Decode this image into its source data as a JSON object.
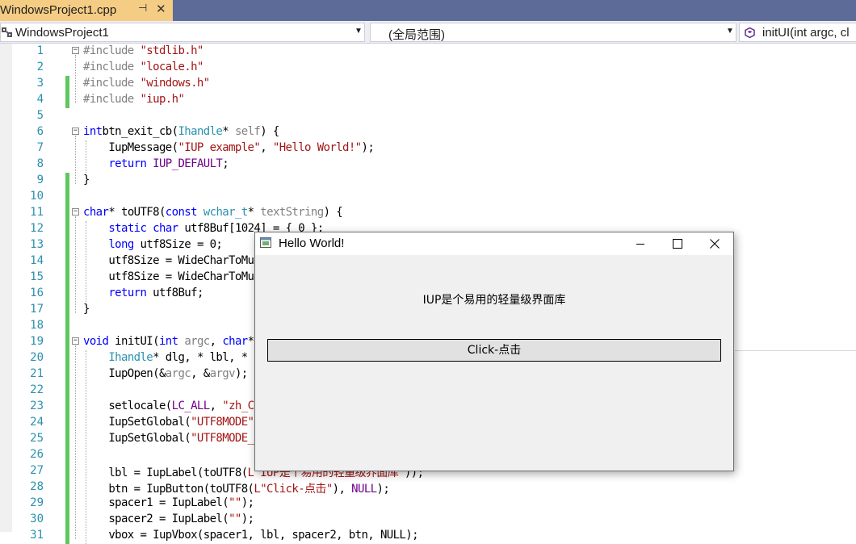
{
  "tab": {
    "title": "WindowsProject1.cpp",
    "pin_icon": "pin-icon",
    "close_icon": "close-icon"
  },
  "nav": {
    "project": "WindowsProject1",
    "scope": "(全局范围)",
    "member": "initUI(int argc, cl"
  },
  "code_lines": [
    {
      "n": "1",
      "chg": false,
      "fold": true,
      "parts": [
        [
          "pp",
          "#include "
        ],
        [
          "str",
          "\"stdlib.h\""
        ]
      ]
    },
    {
      "n": "2",
      "chg": false,
      "fold": false,
      "parts": [
        [
          "pp",
          "#include "
        ],
        [
          "str",
          "\"locale.h\""
        ]
      ]
    },
    {
      "n": "3",
      "chg": true,
      "fold": false,
      "parts": [
        [
          "pp",
          "#include "
        ],
        [
          "str",
          "\"windows.h\""
        ]
      ]
    },
    {
      "n": "4",
      "chg": true,
      "fold": false,
      "parts": [
        [
          "pp",
          "#include "
        ],
        [
          "str",
          "\"iup.h\""
        ]
      ]
    },
    {
      "n": "5",
      "chg": false,
      "fold": false,
      "parts": []
    },
    {
      "n": "6",
      "chg": false,
      "fold": true,
      "parts": [
        [
          "kw",
          "int"
        ],
        [
          "",
          "btn_exit_cb("
        ],
        [
          "ty",
          "Ihandle"
        ],
        [
          "",
          "* "
        ],
        [
          "prm",
          "self"
        ],
        [
          "",
          ") {"
        ]
      ]
    },
    {
      "n": "7",
      "chg": false,
      "fold": false,
      "parts": [
        [
          "",
          "    IupMessage("
        ],
        [
          "str",
          "\"IUP example\""
        ],
        [
          "",
          ", "
        ],
        [
          "str",
          "\"Hello World!\""
        ],
        [
          "",
          ");"
        ]
      ]
    },
    {
      "n": "8",
      "chg": false,
      "fold": false,
      "parts": [
        [
          "",
          "    "
        ],
        [
          "kw",
          "return"
        ],
        [
          "mac",
          " IUP_DEFAULT"
        ],
        [
          "",
          ";"
        ]
      ]
    },
    {
      "n": "9",
      "chg": true,
      "fold": false,
      "parts": [
        [
          "",
          "}"
        ]
      ]
    },
    {
      "n": "10",
      "chg": true,
      "fold": false,
      "parts": []
    },
    {
      "n": "11",
      "chg": true,
      "fold": true,
      "parts": [
        [
          "kw",
          "char"
        ],
        [
          "",
          "* toUTF8("
        ],
        [
          "kw",
          "const"
        ],
        [
          "",
          " "
        ],
        [
          "ty",
          "wchar_t"
        ],
        [
          "",
          "* "
        ],
        [
          "prm",
          "textString"
        ],
        [
          "",
          ") {"
        ]
      ]
    },
    {
      "n": "12",
      "chg": true,
      "fold": false,
      "parts": [
        [
          "",
          "    "
        ],
        [
          "kw",
          "static"
        ],
        [
          "",
          " "
        ],
        [
          "kw",
          "char"
        ],
        [
          "",
          " utf8Buf[1024] = { 0 };"
        ]
      ]
    },
    {
      "n": "13",
      "chg": true,
      "fold": false,
      "parts": [
        [
          "",
          "    "
        ],
        [
          "kw",
          "long"
        ],
        [
          "",
          " utf8Size = 0;"
        ]
      ]
    },
    {
      "n": "14",
      "chg": true,
      "fold": false,
      "parts": [
        [
          "",
          "    utf8Size = WideCharToMu"
        ]
      ]
    },
    {
      "n": "15",
      "chg": true,
      "fold": false,
      "parts": [
        [
          "",
          "    utf8Size = WideCharToMu"
        ]
      ]
    },
    {
      "n": "16",
      "chg": true,
      "fold": false,
      "parts": [
        [
          "",
          "    "
        ],
        [
          "kw",
          "return"
        ],
        [
          "",
          " utf8Buf;"
        ]
      ]
    },
    {
      "n": "17",
      "chg": true,
      "fold": false,
      "parts": [
        [
          "",
          "}"
        ]
      ]
    },
    {
      "n": "18",
      "chg": true,
      "fold": false,
      "parts": []
    },
    {
      "n": "19",
      "chg": true,
      "fold": true,
      "parts": [
        [
          "kw",
          "void"
        ],
        [
          "",
          " initUI("
        ],
        [
          "kw",
          "int"
        ],
        [
          "",
          " "
        ],
        [
          "prm",
          "argc"
        ],
        [
          "",
          ", "
        ],
        [
          "kw",
          "char"
        ],
        [
          "",
          "*"
        ]
      ]
    },
    {
      "n": "20",
      "chg": true,
      "fold": false,
      "parts": [
        [
          "",
          "    "
        ],
        [
          "ty",
          "Ihandle"
        ],
        [
          "",
          "* dlg, * lbl, *"
        ]
      ]
    },
    {
      "n": "21",
      "chg": true,
      "fold": false,
      "parts": [
        [
          "",
          "    IupOpen(&"
        ],
        [
          "prm",
          "argc"
        ],
        [
          "",
          ", &"
        ],
        [
          "prm",
          "argv"
        ],
        [
          "",
          ");"
        ]
      ]
    },
    {
      "n": "22",
      "chg": true,
      "fold": false,
      "parts": []
    },
    {
      "n": "23",
      "chg": true,
      "fold": false,
      "parts": [
        [
          "",
          "    setlocale("
        ],
        [
          "mac",
          "LC_ALL"
        ],
        [
          "",
          ", "
        ],
        [
          "str",
          "\"zh_C"
        ]
      ]
    },
    {
      "n": "24",
      "chg": true,
      "fold": false,
      "parts": [
        [
          "",
          "    IupSetGlobal("
        ],
        [
          "str",
          "\"UTF8MODE\""
        ]
      ]
    },
    {
      "n": "25",
      "chg": true,
      "fold": false,
      "parts": [
        [
          "",
          "    IupSetGlobal("
        ],
        [
          "str",
          "\"UTF8MODE_"
        ]
      ]
    },
    {
      "n": "26",
      "chg": true,
      "fold": false,
      "parts": []
    },
    {
      "n": "27",
      "chg": true,
      "fold": false,
      "parts": [
        [
          "",
          "    lbl = IupLabel(toUTF8("
        ],
        [
          "str",
          "L\"IUP是个易用的轻量级界面库\""
        ],
        [
          "",
          "));"
        ]
      ]
    },
    {
      "n": "28",
      "chg": true,
      "fold": false,
      "parts": [
        [
          "",
          "    btn = IupButton(toUTF8("
        ],
        [
          "str",
          "L\"Click-点击\""
        ],
        [
          "",
          "), "
        ],
        [
          "mac",
          "NULL"
        ],
        [
          "",
          ");"
        ]
      ]
    },
    {
      "n": "29",
      "chg": true,
      "fold": false,
      "parts": [
        [
          "",
          "    spacer1 = IupLabel("
        ],
        [
          "str",
          "\"\""
        ],
        [
          "",
          ");"
        ]
      ]
    },
    {
      "n": "30",
      "chg": true,
      "fold": false,
      "parts": [
        [
          "",
          "    spacer2 = IupLabel("
        ],
        [
          "str",
          "\"\""
        ],
        [
          "",
          ");"
        ]
      ]
    },
    {
      "n": "31",
      "chg": true,
      "fold": false,
      "parts": [
        [
          "",
          "    vbox = IupVbox(spacer1, lbl, spacer2, btn, NULL);"
        ]
      ]
    }
  ],
  "dialog": {
    "title": "Hello World!",
    "label": "IUP是个易用的轻量级界面库",
    "button": "Click-点击"
  },
  "colors": {
    "tab_active": "#f5cc84",
    "tabstrip": "#5d6b99",
    "line_number": "#2b91af",
    "change_bar": "#5fc75f",
    "keyword": "#0000ff",
    "string": "#a31515",
    "type": "#2b91af",
    "macro": "#6f008a"
  }
}
